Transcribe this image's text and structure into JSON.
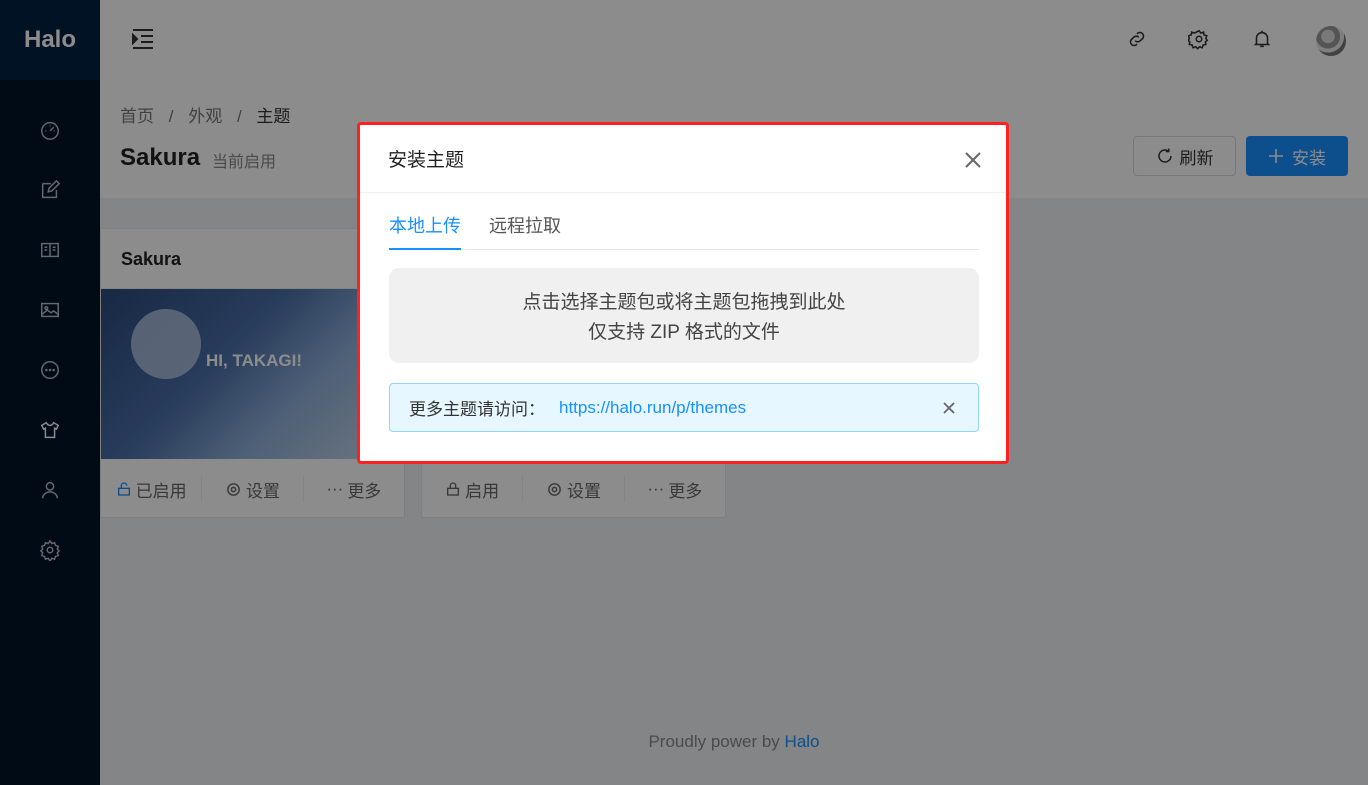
{
  "sidebar": {
    "logo": "Halo",
    "items": [
      {
        "icon": "dashboard-icon"
      },
      {
        "icon": "edit-icon"
      },
      {
        "icon": "book-icon"
      },
      {
        "icon": "image-icon"
      },
      {
        "icon": "comment-icon"
      },
      {
        "icon": "skin-icon"
      },
      {
        "icon": "user-icon"
      },
      {
        "icon": "setting-icon"
      }
    ]
  },
  "header": {
    "icons": [
      "menu-unfold-icon",
      "link-icon",
      "setting-icon",
      "bell-icon",
      "avatar"
    ]
  },
  "page": {
    "breadcrumb": [
      "首页",
      "外观",
      "主题"
    ],
    "breadcrumb_sep": "/",
    "title": "Sakura",
    "subtitle": "当前启用",
    "refresh_label": "刷新",
    "install_label": "安装"
  },
  "cards": [
    {
      "title": "Sakura",
      "image_text": "HI, TAKAGI!",
      "actions": {
        "enable": "已启用",
        "settings": "设置",
        "more": "更多"
      }
    },
    {
      "title": "",
      "actions": {
        "enable": "启用",
        "settings": "设置",
        "more": "更多"
      }
    }
  ],
  "footer": {
    "text": "Proudly power by",
    "link": "Halo"
  },
  "modal": {
    "title": "安装主题",
    "tabs": [
      "本地上传",
      "远程拉取"
    ],
    "active_tab": 0,
    "dropzone": {
      "line1": "点击选择主题包或将主题包拖拽到此处",
      "line2": "仅支持 ZIP 格式的文件"
    },
    "alert": {
      "text": "更多主题请访问：",
      "url": "https://halo.run/p/themes"
    }
  },
  "colors": {
    "primary": "#1890ff",
    "sidebar_bg": "#001529",
    "highlight_border": "#ff2020"
  }
}
